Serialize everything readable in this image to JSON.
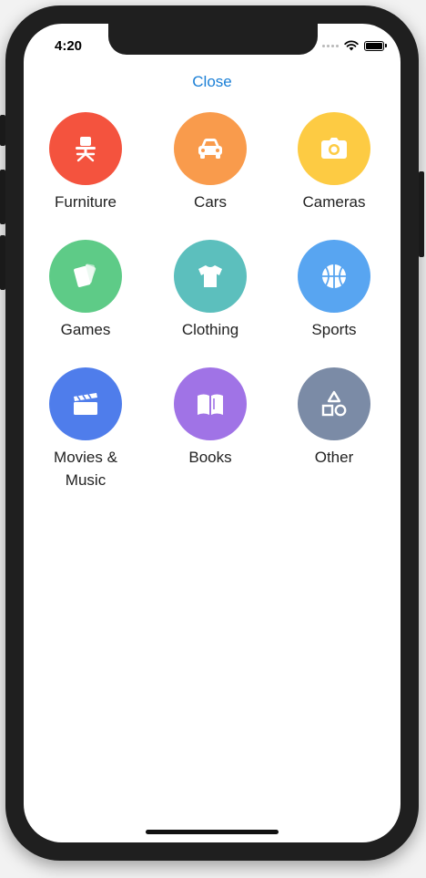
{
  "status_bar": {
    "time": "4:20"
  },
  "header": {
    "close_label": "Close"
  },
  "categories": [
    {
      "label": "Furniture",
      "icon": "chair-icon",
      "color": "#f4533e"
    },
    {
      "label": "Cars",
      "icon": "car-icon",
      "color": "#f99b4c"
    },
    {
      "label": "Cameras",
      "icon": "camera-icon",
      "color": "#fdcb43"
    },
    {
      "label": "Games",
      "icon": "cards-icon",
      "color": "#5ecb87"
    },
    {
      "label": "Clothing",
      "icon": "tshirt-icon",
      "color": "#5cbfbd"
    },
    {
      "label": "Sports",
      "icon": "basketball-icon",
      "color": "#58a5f1"
    },
    {
      "label": "Movies & Music",
      "icon": "clapperboard-icon",
      "color": "#4f7deb"
    },
    {
      "label": "Books",
      "icon": "book-icon",
      "color": "#a073e6"
    },
    {
      "label": "Other",
      "icon": "shapes-icon",
      "color": "#7b8ba6"
    }
  ],
  "colors": {
    "accent": "#1a7fd6"
  }
}
